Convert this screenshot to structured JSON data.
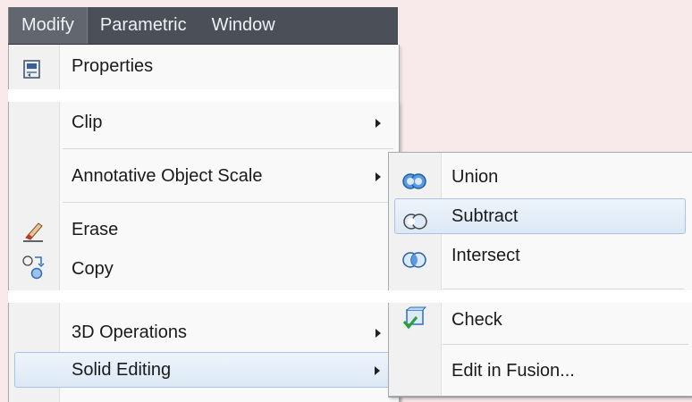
{
  "menubar": {
    "items": [
      {
        "label": "Modify"
      },
      {
        "label": "Parametric"
      },
      {
        "label": "Window"
      }
    ]
  },
  "modify_menu": {
    "items": [
      {
        "label": "Properties",
        "icon": "properties-icon"
      },
      {
        "label": "Clip",
        "submenu": true
      },
      {
        "label": "Annotative Object Scale",
        "submenu": true
      },
      {
        "label": "Erase",
        "icon": "eraser-icon"
      },
      {
        "label": "Copy",
        "icon": "copy-icon"
      },
      {
        "label": "3D Operations",
        "submenu": true
      },
      {
        "label": "Solid Editing",
        "submenu": true,
        "highlighted": true
      }
    ]
  },
  "solid_editing_submenu": {
    "items": [
      {
        "label": "Union",
        "icon": "union-icon"
      },
      {
        "label": "Subtract",
        "icon": "subtract-icon",
        "highlighted": true
      },
      {
        "label": "Intersect",
        "icon": "intersect-icon"
      },
      {
        "label": "Check",
        "icon": "check-icon"
      },
      {
        "label": "Edit in Fusion..."
      }
    ]
  },
  "colors": {
    "menubar_bg": "#4b5058",
    "menubar_active": "#62676f",
    "highlight_border": "#a9c4e2",
    "icon_blue": "#2e6fb8"
  }
}
